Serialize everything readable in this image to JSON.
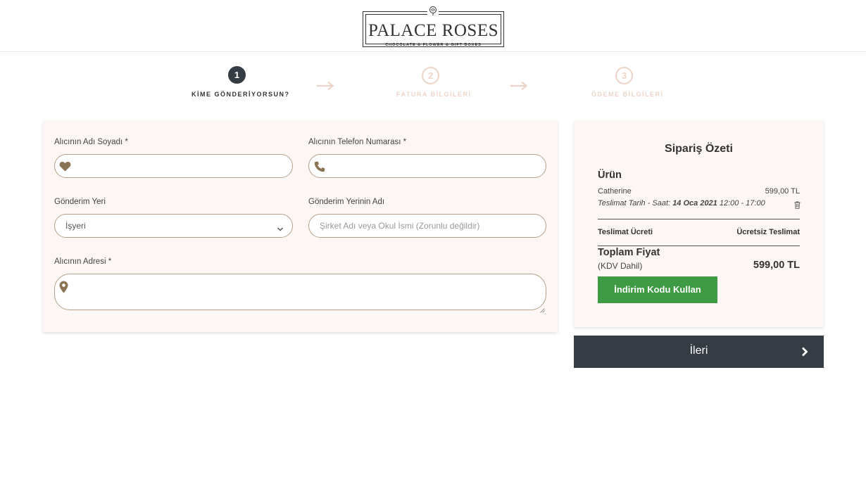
{
  "brand": {
    "name": "PALACE ROSES",
    "tagline": "CHOCOLATE & FLOWER & GIFT BOXES"
  },
  "steps": [
    {
      "number": "1",
      "label": "KİME GÖNDERİYORSUN?",
      "active": true
    },
    {
      "number": "2",
      "label": "FATURA BİLGİLERİ",
      "active": false
    },
    {
      "number": "3",
      "label": "ÖDEME BİLGİLERİ",
      "active": false
    }
  ],
  "form": {
    "recipient_name_label": "Alıcının Adı Soyadı *",
    "recipient_phone_label": "Alıcının Telefon Numarası *",
    "delivery_place_label": "Gönderim Yeri",
    "delivery_place_value": "İşyeri",
    "delivery_place_name_label": "Gönderim Yerinin Adı",
    "delivery_place_name_placeholder": "Şirket Adı veya Okul İsmi (Zorunlu değildir)",
    "address_label": "Alıcının Adresi *"
  },
  "summary": {
    "title": "Sipariş Özeti",
    "product_heading": "Ürün",
    "product_name": "Catherine",
    "product_price": "599,00 TL",
    "delivery_prefix": "Teslimat Tarih - Saat:",
    "delivery_date": "14 Oca 2021",
    "delivery_time": "12:00 - 17:00",
    "shipping_label": "Teslimat Ücreti",
    "shipping_value": "Ücretsiz Teslimat",
    "total_label": "Toplam Fiyat",
    "vat_note": "(KDV Dahil)",
    "total_value": "599,00 TL",
    "discount_button": "İndirim Kodu Kullan"
  },
  "next_button": "İleri",
  "colors": {
    "accent_dark": "#353c44",
    "accent_green": "#3e9a43",
    "field_border": "#b3a089",
    "icon_brown": "#8b7355",
    "step_inactive": "#ecd5c8",
    "card_bg": "#fcf7f4"
  }
}
